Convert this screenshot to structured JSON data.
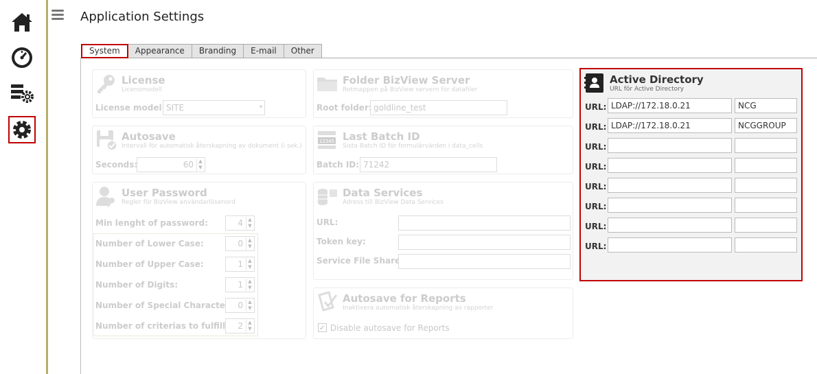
{
  "sidebar": {
    "items": [
      {
        "icon": "home-icon"
      },
      {
        "icon": "dashboard-gauge-icon"
      },
      {
        "icon": "server-settings-icon"
      },
      {
        "icon": "gear-icon",
        "selected": true
      }
    ]
  },
  "header": {
    "title": "Application Settings"
  },
  "tabs": [
    {
      "label": "System",
      "active": true
    },
    {
      "label": "Appearance"
    },
    {
      "label": "Branding"
    },
    {
      "label": "E-mail"
    },
    {
      "label": "Other"
    }
  ],
  "license": {
    "title": "License",
    "subtitle": "Licensmodell",
    "model_label": "License model:",
    "model_value": "SITE"
  },
  "autosave": {
    "title": "Autosave",
    "subtitle": "Intervall för automatisk återskapning av dokument (i sek.)",
    "seconds_label": "Seconds:",
    "seconds_value": "60"
  },
  "user_password": {
    "title": "User Password",
    "subtitle": "Regler för BizView användarlösenord",
    "min_length_label": "Min lenght of password:",
    "min_length_value": "4",
    "lower_label": "Number of Lower Case:",
    "lower_value": "0",
    "upper_label": "Number of Upper Case:",
    "upper_value": "1",
    "digits_label": "Number of Digits:",
    "digits_value": "1",
    "special_label": "Number of Special Characters:",
    "special_value": "0",
    "criterias_label": "Number of criterias to fulfill:",
    "criterias_value": "2"
  },
  "folder": {
    "title": "Folder BizView Server",
    "subtitle": "Rotmappen på BizView servern för datafiler",
    "root_label": "Root folder:",
    "root_value": "goldline_test"
  },
  "batch": {
    "title": "Last Batch ID",
    "subtitle": "Sista Batch ID för formulärvärden i data_cells",
    "id_label": "Batch ID:",
    "id_value": "71242"
  },
  "data_services": {
    "title": "Data Services",
    "subtitle": "Adress till BizView Data Services",
    "url_label": "URL:",
    "token_label": "Token key:",
    "share_label": "Service File Share:"
  },
  "autosave_reports": {
    "title": "Autosave for Reports",
    "subtitle": "Inaktivera automatisk återskapning av rapporter",
    "checkbox_label": "Disable autosave for Reports",
    "checked": true
  },
  "active_directory": {
    "title": "Active Directory",
    "subtitle": "URL för Active Directory",
    "url_label": "URL:",
    "rows": [
      {
        "url": "LDAP://172.18.0.21",
        "domain": "NCG"
      },
      {
        "url": "LDAP://172.18.0.21",
        "domain": "NCGGROUP"
      },
      {
        "url": "",
        "domain": ""
      },
      {
        "url": "",
        "domain": ""
      },
      {
        "url": "",
        "domain": ""
      },
      {
        "url": "",
        "domain": ""
      },
      {
        "url": "",
        "domain": ""
      },
      {
        "url": "",
        "domain": ""
      }
    ]
  },
  "colors": {
    "accent_border": "#c00000",
    "sidebar_line": "#b8ae6a"
  }
}
